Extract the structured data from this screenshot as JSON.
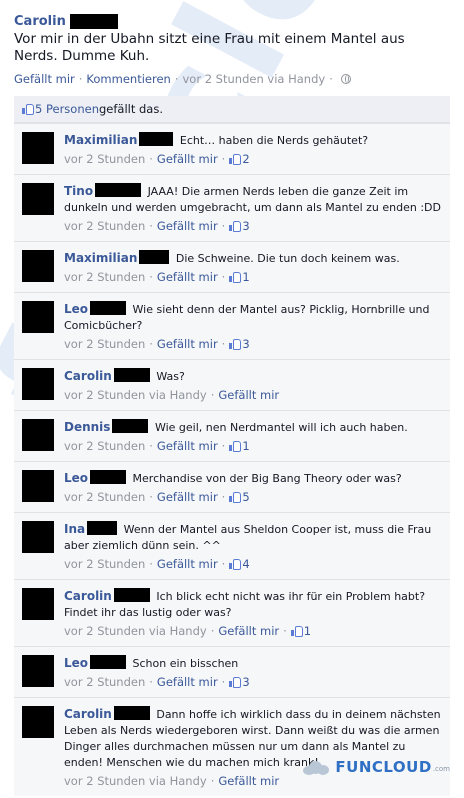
{
  "watermark": {
    "text": "funcloud",
    "suffix": ".com"
  },
  "post": {
    "author": "Carolin",
    "text": "Vor mir in der Ubahn sitzt eine Frau mit einem Mantel aus Nerds. Dumme Kuh.",
    "like_label": "Gefällt mir",
    "dot": "·",
    "comment_label": "Kommentieren",
    "time": "vor 2 Stunden via Handy",
    "globe_icon": "globe-icon"
  },
  "likes": {
    "count_text": "5 Personen",
    "suffix": " gefällt das."
  },
  "comments": [
    {
      "name": "Maximilian",
      "censor_w": 34,
      "text": "Echt… haben die Nerds gehäutet?",
      "time": "vor 2 Stunden",
      "like_label": "Gefällt mir",
      "likes": "2"
    },
    {
      "name": "Tino",
      "censor_w": 46,
      "text": "JAAA! Die armen Nerds leben die ganze Zeit im dunkeln und werden umgebracht, um dann als Mantel zu enden :DD",
      "time": "vor 2 Stunden",
      "like_label": "Gefällt mir",
      "likes": "3"
    },
    {
      "name": "Maximilian",
      "censor_w": 30,
      "text": "Die Schweine. Die tun doch keinem was.",
      "time": "vor 2 Stunden",
      "like_label": "Gefällt mir",
      "likes": "1"
    },
    {
      "name": "Leo",
      "censor_w": 36,
      "text": "Wie sieht denn der Mantel aus? Picklig, Hornbrille und Comicbücher?",
      "time": "vor 2 Stunden",
      "like_label": "Gefällt mir",
      "likes": "3"
    },
    {
      "name": "Carolin",
      "censor_w": 36,
      "text": "Was?",
      "time": "vor 2 Stunden via Handy",
      "like_label": "Gefällt mir",
      "likes": ""
    },
    {
      "name": "Dennis",
      "censor_w": 36,
      "text": "Wie geil, nen Nerdmantel will ich auch haben.",
      "time": "vor 2 Stunden",
      "like_label": "Gefällt mir",
      "likes": "1"
    },
    {
      "name": "Leo",
      "censor_w": 36,
      "text": "Merchandise von der Big Bang Theory oder was?",
      "time": "vor 2 Stunden",
      "like_label": "Gefällt mir",
      "likes": "5"
    },
    {
      "name": "Ina",
      "censor_w": 30,
      "text": "Wenn der Mantel aus Sheldon Cooper ist, muss die Frau aber ziemlich dünn sein. ^^",
      "time": "vor 2 Stunden",
      "like_label": "Gefällt mir",
      "likes": "4"
    },
    {
      "name": "Carolin",
      "censor_w": 36,
      "text": "Ich blick echt nicht was ihr für ein Problem habt? Findet ihr das lustig oder was?",
      "time": "vor 2 Stunden via Handy",
      "like_label": "Gefällt mir",
      "likes": "1"
    },
    {
      "name": "Leo",
      "censor_w": 36,
      "text": "Schon ein bisschen",
      "time": "vor 2 Stunden",
      "like_label": "Gefällt mir",
      "likes": "3"
    },
    {
      "name": "Carolin",
      "censor_w": 36,
      "text": "Dann hoffe ich wirklich dass du in deinem nächsten Leben als Nerds wiedergeboren wirst. Dann weißt du was die armen Dinger alles durchmachen müssen nur um dann als Mantel zu enden! Menschen wie du machen mich krank!",
      "time": "vor 2 Stunden via Handy",
      "like_label": "Gefällt mir",
      "likes": ""
    }
  ],
  "logo": {
    "fun": "FUN",
    "cloud": "CLOUD",
    "com": ".com"
  },
  "colors": {
    "link": "#3b5998",
    "meta": "#90949c",
    "comments_bg": "#f6f7f9",
    "likes_bg": "#edeff4"
  }
}
